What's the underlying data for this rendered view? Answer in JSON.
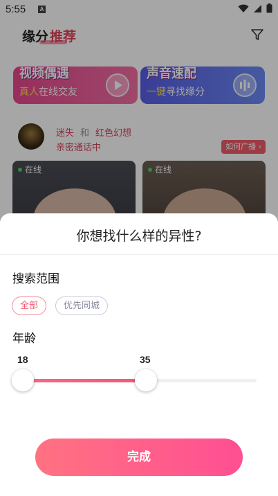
{
  "statusbar": {
    "time": "5:55",
    "notif_letter": "A"
  },
  "header": {
    "tab_fate": "缘分",
    "tab_recommend": "推荐",
    "filter_icon": "filter-icon"
  },
  "banners": [
    {
      "title": "视频偶遇",
      "sub_highlight": "真人",
      "sub_rest": "在线交友",
      "icon": "play-icon"
    },
    {
      "title": "声音速配",
      "sub_highlight": "一键",
      "sub_rest": "寻找缘分",
      "icon": "soundwave-icon"
    }
  ],
  "match_notice": {
    "user_a": "迷失",
    "joiner": "和",
    "user_b": "红色幻想",
    "status": "亲密通话中",
    "howto_label": "如何广播"
  },
  "cards": [
    {
      "online_label": "在线"
    },
    {
      "online_label": "在线"
    }
  ],
  "sheet": {
    "title": "你想找什么样的异性?",
    "range_label": "搜索范围",
    "range_options": [
      "全部",
      "优先同城"
    ],
    "range_selected": "全部",
    "age_label": "年龄",
    "age_min": "18",
    "age_max": "35",
    "done_label": "完成"
  },
  "colors": {
    "accent": "#ef5a73",
    "done_start": "#ff7281",
    "done_end": "#ff4f93"
  }
}
